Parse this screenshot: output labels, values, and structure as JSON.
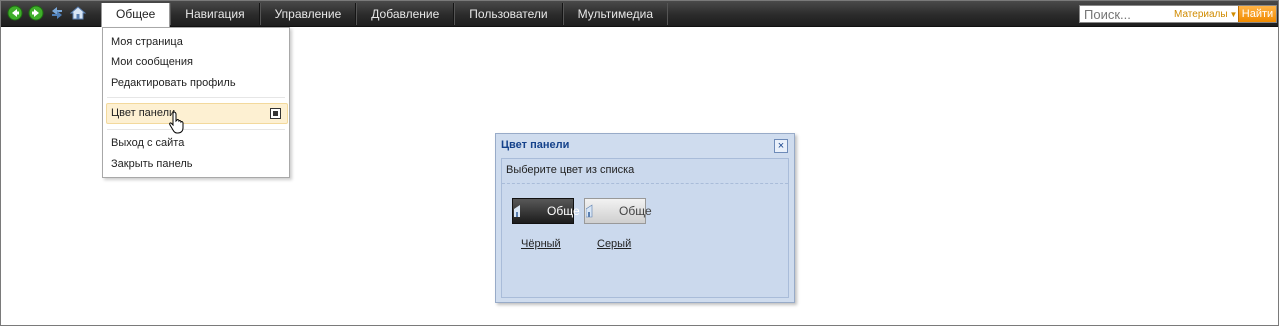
{
  "topbar": {
    "icons": [
      "back-arrow-icon",
      "forward-arrow-icon",
      "refresh-icon",
      "home-icon"
    ],
    "menu": [
      "Общее",
      "Навигация",
      "Управление",
      "Добавление",
      "Пользователи",
      "Мультимедиа"
    ],
    "active_menu": "Общее",
    "search": {
      "placeholder": "Поиск...",
      "scope": "Материалы",
      "button": "Найти"
    }
  },
  "dropdown": {
    "items": [
      "Моя страница",
      "Мои сообщения",
      "Редактировать профиль",
      "Цвет панели",
      "Выход с сайта",
      "Закрыть панель"
    ],
    "highlighted": "Цвет панели"
  },
  "dialog": {
    "title": "Цвет панели",
    "close": "×",
    "prompt": "Выберите цвет из списка",
    "options": [
      {
        "preview_label": "Обще",
        "caption": "Чёрный"
      },
      {
        "preview_label": "Обще",
        "caption": "Серый"
      }
    ]
  },
  "colors": {
    "accent": "#f08a00",
    "panel_dark": "#2b2b2b",
    "dialog_bg": "#cfdcee",
    "title": "#15428b"
  }
}
